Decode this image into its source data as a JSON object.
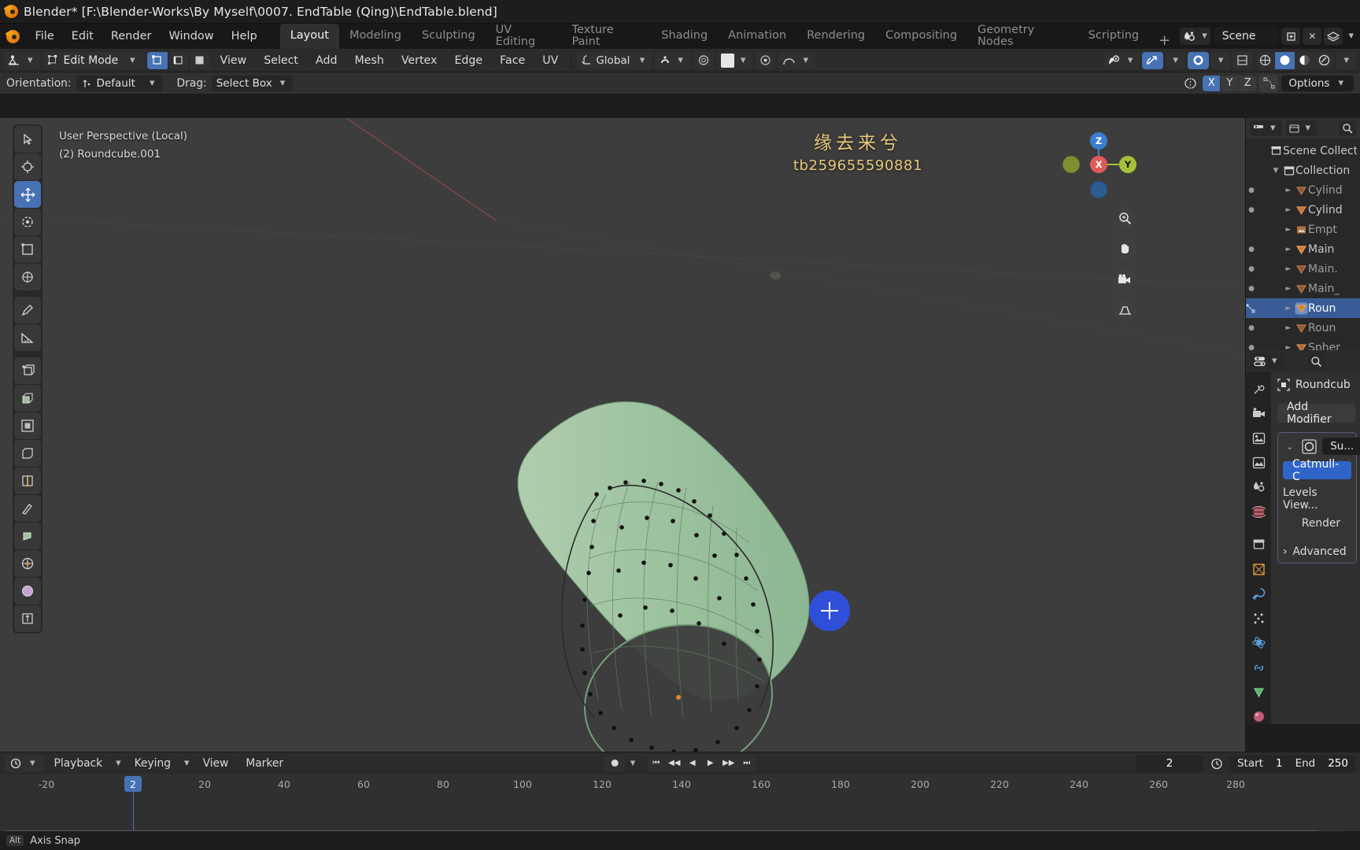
{
  "window": {
    "title": "Blender* [F:\\Blender-Works\\By Myself\\0007. EndTable (Qing)\\EndTable.blend]",
    "logo_icon": "blender-logo-icon"
  },
  "topbar": {
    "menus": [
      "File",
      "Edit",
      "Render",
      "Window",
      "Help"
    ],
    "workspace_tabs": [
      "Layout",
      "Modeling",
      "Sculpting",
      "UV Editing",
      "Texture Paint",
      "Shading",
      "Animation",
      "Rendering",
      "Compositing",
      "Geometry Nodes",
      "Scripting"
    ],
    "active_workspace": "Layout",
    "add_workspace": "+",
    "scene_name": "Scene",
    "scene_icon": "scene-data-icon",
    "new_scene_icon": "new-scene-icon",
    "remove_scene_icon": "close-icon",
    "viewlayer_icon": "view-layer-icon"
  },
  "viewport_header": {
    "editor_type_icon": "editor-type-editmode-icon",
    "mode": "Edit Mode",
    "mode_icon": "edit-mode-icon",
    "select_modes": [
      "vertex-select-icon",
      "edge-select-icon",
      "face-select-icon"
    ],
    "active_select_mode": 0,
    "menus": [
      "View",
      "Select",
      "Add",
      "Mesh",
      "Vertex",
      "Edge",
      "Face",
      "UV"
    ],
    "transform_orientation": "Global",
    "transform_orientation_icon": "orientation-global-icon",
    "snap_icon": "magnet-icon",
    "proportional_icon": "proportional-edit-icon",
    "falloff_icon": "falloff-smooth-icon",
    "mirror_icon": "mirror-x-icon",
    "right_icons": [
      "visibility-icon",
      "gizmo-icon",
      "overlays-icon",
      "xray-icon",
      "shading-wireframe-icon",
      "shading-solid-icon",
      "shading-material-icon",
      "shading-rendered-icon"
    ],
    "active_shading": "shading-solid-icon"
  },
  "tool_settings": {
    "orientation_label": "Orientation:",
    "orientation_value": "Default",
    "orientation_icon": "orientation-default-icon",
    "drag_label": "Drag:",
    "drag_value": "Select Box",
    "mirror_icon": "mirror-icon",
    "axes": [
      "X",
      "Y",
      "Z"
    ],
    "active_axes": [
      "X"
    ],
    "snap_icon": "snap-vertex-icon",
    "options_label": "Options"
  },
  "viewport": {
    "perspective_label": "User Perspective (Local)",
    "object_label": "(2) Roundcube.001",
    "watermark_line1": "缘去来兮",
    "watermark_line2": "tb259655590881",
    "watermark_color": "#e8c77a",
    "background_color": "#3d3d3d",
    "mesh_color": "#9cc3a0",
    "cursor_color": "#2f4fd8",
    "toolbar": [
      "tweak-select-tool",
      "cursor-tool",
      "move-tool",
      "rotate-tool",
      "scale-tool",
      "transform-tool",
      "annotate-tool",
      "measure-tool",
      "add-cube-tool",
      "extrude-region-tool",
      "inset-faces-tool",
      "bevel-tool",
      "loop-cut-tool",
      "knife-tool",
      "poly-build-tool",
      "spin-tool",
      "smooth-tool",
      "shrink-fatten-tool"
    ],
    "active_tool": "move-tool",
    "gizmo": {
      "x": "X",
      "y": "Y",
      "z": "Z",
      "x_color": "#e05a5a",
      "y_color": "#a5c137",
      "z_color": "#3b7ed0"
    },
    "nav_buttons": [
      "zoom-icon",
      "pan-hand-icon",
      "camera-view-icon",
      "toggle-ortho-icon"
    ]
  },
  "outliner": {
    "display_mode_icon": "outliner-display-icon",
    "filter_icon": "filter-icon",
    "search_icon": "search-icon",
    "rows": [
      {
        "name": "Scene Collect",
        "icon": "scene-collection-icon",
        "indent": 0,
        "expander": "",
        "dim": false,
        "selected": false,
        "visibility": false
      },
      {
        "name": "Collection",
        "icon": "collection-icon",
        "indent": 1,
        "expander": "▼",
        "dim": false,
        "selected": false,
        "visibility": false
      },
      {
        "name": "Cylind",
        "icon": "mesh-icon",
        "indent": 2,
        "expander": "►",
        "dim": true,
        "selected": false,
        "visibility": true
      },
      {
        "name": "Cylind",
        "icon": "mesh-icon",
        "indent": 2,
        "expander": "►",
        "dim": false,
        "selected": false,
        "visibility": true
      },
      {
        "name": "Empt",
        "icon": "empty-image-icon",
        "indent": 2,
        "expander": "►",
        "dim": true,
        "selected": false,
        "visibility": false
      },
      {
        "name": "Main",
        "icon": "mesh-icon",
        "indent": 2,
        "expander": "►",
        "dim": false,
        "selected": false,
        "visibility": true
      },
      {
        "name": "Main.",
        "icon": "mesh-icon",
        "indent": 2,
        "expander": "►",
        "dim": true,
        "selected": false,
        "visibility": true
      },
      {
        "name": "Main_",
        "icon": "mesh-icon",
        "indent": 2,
        "expander": "►",
        "dim": true,
        "selected": false,
        "visibility": true
      },
      {
        "name": "Roun",
        "icon": "mesh-icon",
        "indent": 2,
        "expander": "►",
        "dim": false,
        "selected": true,
        "visibility": true
      },
      {
        "name": "Roun",
        "icon": "mesh-icon",
        "indent": 2,
        "expander": "►",
        "dim": true,
        "selected": false,
        "visibility": true
      },
      {
        "name": "Spher",
        "icon": "mesh-icon",
        "indent": 2,
        "expander": "►",
        "dim": true,
        "selected": false,
        "visibility": true
      }
    ]
  },
  "properties": {
    "editor_icon": "properties-editor-icon",
    "search_icon": "search-icon",
    "object_name": "Roundcub",
    "object_icon": "object-data-icon",
    "add_modifier": "Add Modifier",
    "modifier": {
      "expand_icon": "chevron-down-icon",
      "type_icon": "subsurf-modifier-icon",
      "name": "Su...",
      "subdivision_type": "Catmull-C",
      "levels_label": "Levels View...",
      "render_label": "Render",
      "advanced_label": "Advanced",
      "advanced_icon": "chevron-right-icon"
    },
    "tabs": [
      "tool-tab",
      "render-tab",
      "output-tab",
      "view-layer-tab",
      "scene-tab",
      "world-tab",
      "collection-tab",
      "object-tab",
      "modifier-tab",
      "particles-tab",
      "physics-tab",
      "constraints-tab",
      "data-tab",
      "material-tab"
    ],
    "active_tab": "modifier-tab"
  },
  "timeline": {
    "editor_icon": "timeline-editor-icon",
    "menus_left": [
      "Playback",
      "Keying",
      "View",
      "Marker"
    ],
    "record_icon": "record-icon",
    "transport": [
      "jump-start-icon",
      "prev-keyframe-icon",
      "play-reverse-icon",
      "play-icon",
      "next-keyframe-icon",
      "jump-end-icon"
    ],
    "current_frame": "2",
    "clock_icon": "auto-key-icon",
    "start_label": "Start",
    "start_value": "1",
    "end_label": "End",
    "end_value": "250",
    "ruler_ticks": [
      "-20",
      "20",
      "40",
      "60",
      "80",
      "100",
      "120",
      "140",
      "160",
      "180",
      "200",
      "220",
      "240",
      "260",
      "280"
    ],
    "playhead_label": "2"
  },
  "statusbar": {
    "key": "Alt",
    "text": "Axis Snap"
  }
}
